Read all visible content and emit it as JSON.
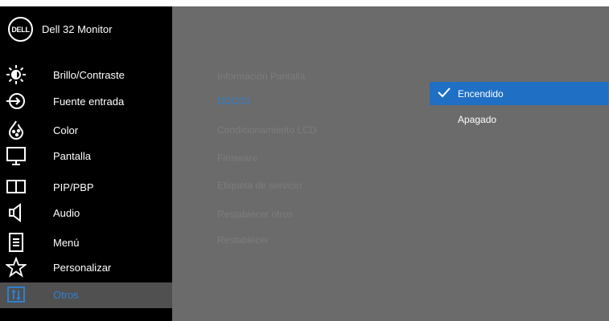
{
  "header": {
    "logo_text": "DELL",
    "title": "Dell 32 Monitor"
  },
  "menu": {
    "items": [
      {
        "label": "Brillo/Contraste",
        "icon": "brightness-icon"
      },
      {
        "label": "Fuente entrada",
        "icon": "input-source-icon"
      },
      {
        "label": "Color",
        "icon": "color-palette-icon"
      },
      {
        "label": "Pantalla",
        "icon": "display-icon"
      },
      {
        "label": "PIP/PBP",
        "icon": "pip-pbp-icon"
      },
      {
        "label": "Audio",
        "icon": "speaker-icon"
      },
      {
        "label": "Menú",
        "icon": "menu-list-icon"
      },
      {
        "label": "Personalizar",
        "icon": "star-icon"
      },
      {
        "label": "Otros",
        "icon": "others-icon",
        "selected": true
      }
    ]
  },
  "submenu": {
    "items": [
      {
        "label": "Información Pantalla"
      },
      {
        "label": "DDC/CI",
        "active": true
      },
      {
        "label": "Condicionamiento LCD"
      },
      {
        "label": "Firmware"
      },
      {
        "label": "Etiqueta de servicio"
      },
      {
        "label": "Restablecer otros"
      },
      {
        "label": "Restablecer"
      }
    ]
  },
  "options": {
    "items": [
      {
        "label": "Encendido",
        "checked": true
      },
      {
        "label": "Apagado",
        "checked": false
      }
    ]
  },
  "colors": {
    "sidebar_bg": "#000000",
    "main_bg": "#6b6b6b",
    "accent_blue": "#1f6fc5",
    "active_text": "#2f7fcf"
  }
}
